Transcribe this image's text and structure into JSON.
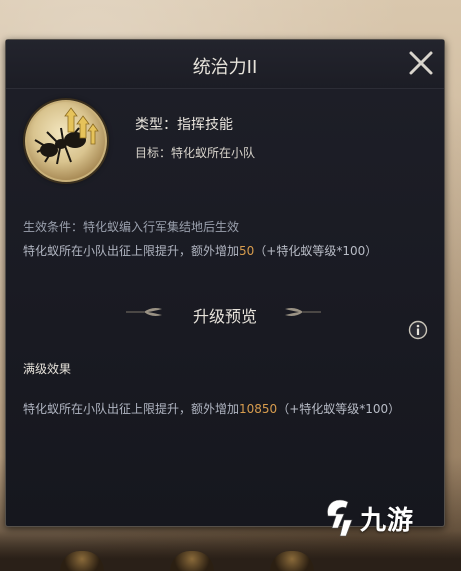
{
  "panel": {
    "title": "统治力II",
    "close_icon": "close-x-icon"
  },
  "skill": {
    "icon": "ant-upgrade-icon",
    "type_text": "类型：指挥技能",
    "target_text": "目标：特化蚁所在小队"
  },
  "condition": {
    "text": "生效条件：特化蚁编入行军集结地后生效"
  },
  "current_effect": {
    "prefix": "特化蚁所在小队出征上限提升，额外增加",
    "value": "50",
    "suffix": "（+特化蚁等级*100）"
  },
  "upgrade_preview": {
    "heading": "升级预览",
    "info_icon": "info-icon",
    "max_label": "满级效果",
    "prefix": "特化蚁所在小队出征上限提升，额外增加",
    "value": "10850",
    "suffix": "（+特化蚁等级*100）"
  },
  "watermark": {
    "text": "九游"
  },
  "colors": {
    "highlight": "#d79c4e",
    "panel_bg": "#1c1d25",
    "title_text": "#e6e2da"
  }
}
